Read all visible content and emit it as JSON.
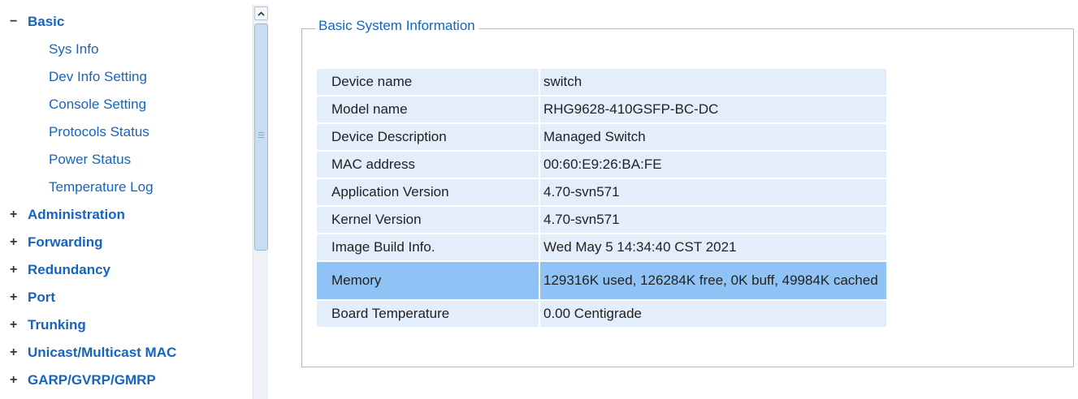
{
  "sidebar": {
    "expanded_group": {
      "toggle": "−",
      "label": "Basic"
    },
    "sub_items": [
      "Sys Info",
      "Dev Info Setting",
      "Console Setting",
      "Protocols Status",
      "Power Status",
      "Temperature Log"
    ],
    "collapsed_groups": [
      {
        "toggle": "+",
        "label": "Administration"
      },
      {
        "toggle": "+",
        "label": "Forwarding"
      },
      {
        "toggle": "+",
        "label": "Redundancy"
      },
      {
        "toggle": "+",
        "label": "Port"
      },
      {
        "toggle": "+",
        "label": "Trunking"
      },
      {
        "toggle": "+",
        "label": "Unicast/Multicast MAC"
      },
      {
        "toggle": "+",
        "label": "GARP/GVRP/GMRP"
      }
    ],
    "scroll_up_icon": "chevron-up-icon"
  },
  "main": {
    "legend": "Basic System Information",
    "rows": [
      {
        "label": "Device name",
        "value": "switch"
      },
      {
        "label": "Model name",
        "value": "RHG9628-410GSFP-BC-DC"
      },
      {
        "label": "Device Description",
        "value": "Managed Switch"
      },
      {
        "label": "MAC address",
        "value": "00:60:E9:26:BA:FE"
      },
      {
        "label": "Application Version",
        "value": "4.70-svn571"
      },
      {
        "label": "Kernel Version",
        "value": "4.70-svn571"
      },
      {
        "label": "Image Build Info.",
        "value": "Wed May 5 14:34:40 CST 2021"
      },
      {
        "label": "Memory",
        "value": "129316K used, 126284K free, 0K buff, 49984K cached"
      },
      {
        "label": "Board Temperature",
        "value": "0.00 Centigrade"
      }
    ]
  },
  "colors": {
    "link": "#1565c0",
    "row_bg": "#e4edfa",
    "row_highlight": "#90c3f5"
  }
}
